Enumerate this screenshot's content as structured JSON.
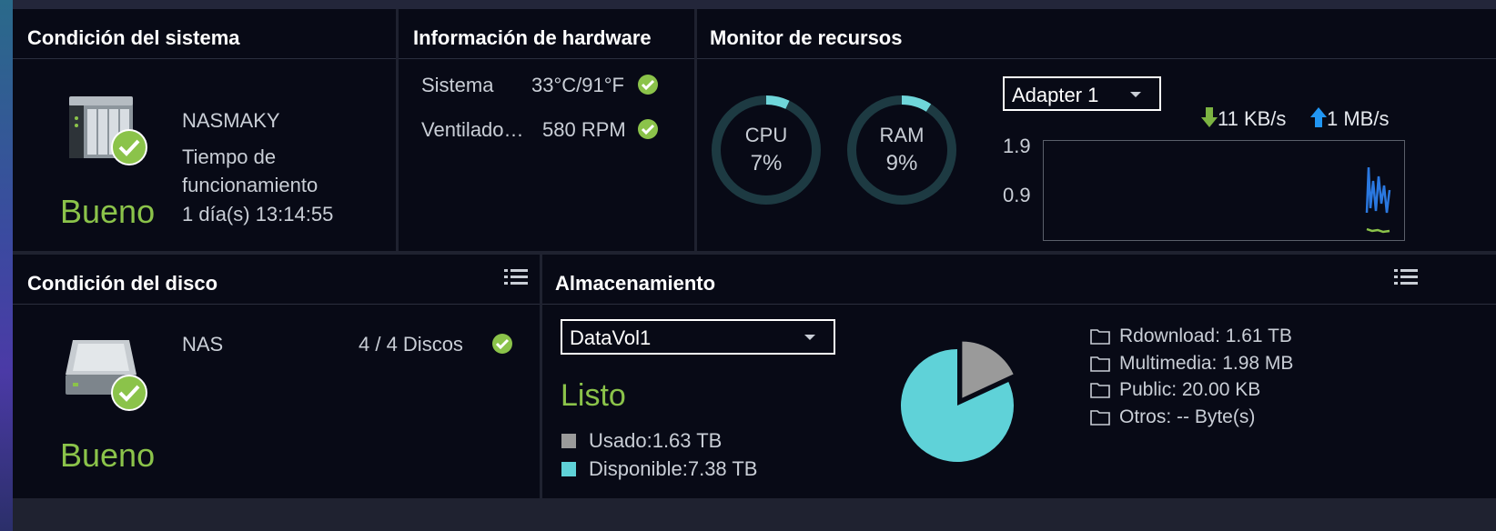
{
  "system_health": {
    "title": "Condición del sistema",
    "device_name": "NASMAKY",
    "uptime_label_1": "Tiempo de",
    "uptime_label_2": "funcionamiento",
    "uptime_value": "1 día(s) 13:14:55",
    "status": "Bueno"
  },
  "hardware": {
    "title": "Información de hardware",
    "rows": [
      {
        "label": "Sistema",
        "value": "33°C/91°F"
      },
      {
        "label": "Ventilado…",
        "value": "580 RPM"
      }
    ]
  },
  "resource_monitor": {
    "title": "Monitor de recursos",
    "cpu": {
      "label": "CPU",
      "value": "7%",
      "percent": 7
    },
    "ram": {
      "label": "RAM",
      "value": "9%",
      "percent": 9
    },
    "adapter": "Adapter 1",
    "download": "11 KB/s",
    "upload": "1 MB/s",
    "y_tick_top": "1.9",
    "y_tick_mid": "0.9"
  },
  "disk_health": {
    "title": "Condición del disco",
    "device": "NAS",
    "disks": "4 / 4 Discos",
    "status": "Bueno"
  },
  "storage": {
    "title": "Almacenamiento",
    "volume": "DataVol1",
    "status": "Listo",
    "used": "Usado:1.63 TB",
    "available": "Disponible:7.38 TB",
    "used_fraction": 0.181,
    "folders": [
      "Rdownload: 1.61 TB",
      "Multimedia: 1.98 MB",
      "Public: 20.00 KB",
      "Otros: -- Byte(s)"
    ]
  },
  "colors": {
    "good": "#8bc34a",
    "ring_accent": "#6fd6da",
    "ring_track": "#1d3a42",
    "pie_available": "#5fd2d8",
    "pie_used": "#9a9a9a",
    "download_arrow": "#7cb342",
    "upload_arrow": "#2196f3",
    "chart_line": "#2a78e0"
  },
  "icons": [
    "nas-server-icon",
    "check-circle-icon",
    "hard-disk-icon",
    "list-menu-icon",
    "folder-icon",
    "download-arrow-icon",
    "upload-arrow-icon"
  ]
}
